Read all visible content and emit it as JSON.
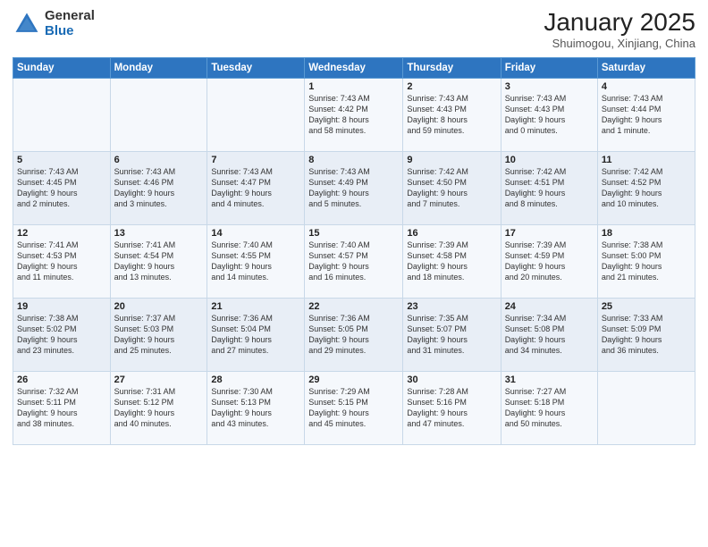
{
  "header": {
    "logo_general": "General",
    "logo_blue": "Blue",
    "title": "January 2025",
    "location": "Shuimogou, Xinjiang, China"
  },
  "calendar": {
    "days_of_week": [
      "Sunday",
      "Monday",
      "Tuesday",
      "Wednesday",
      "Thursday",
      "Friday",
      "Saturday"
    ],
    "weeks": [
      [
        {
          "day": "",
          "content": ""
        },
        {
          "day": "",
          "content": ""
        },
        {
          "day": "",
          "content": ""
        },
        {
          "day": "1",
          "content": "Sunrise: 7:43 AM\nSunset: 4:42 PM\nDaylight: 8 hours\nand 58 minutes."
        },
        {
          "day": "2",
          "content": "Sunrise: 7:43 AM\nSunset: 4:43 PM\nDaylight: 8 hours\nand 59 minutes."
        },
        {
          "day": "3",
          "content": "Sunrise: 7:43 AM\nSunset: 4:43 PM\nDaylight: 9 hours\nand 0 minutes."
        },
        {
          "day": "4",
          "content": "Sunrise: 7:43 AM\nSunset: 4:44 PM\nDaylight: 9 hours\nand 1 minute."
        }
      ],
      [
        {
          "day": "5",
          "content": "Sunrise: 7:43 AM\nSunset: 4:45 PM\nDaylight: 9 hours\nand 2 minutes."
        },
        {
          "day": "6",
          "content": "Sunrise: 7:43 AM\nSunset: 4:46 PM\nDaylight: 9 hours\nand 3 minutes."
        },
        {
          "day": "7",
          "content": "Sunrise: 7:43 AM\nSunset: 4:47 PM\nDaylight: 9 hours\nand 4 minutes."
        },
        {
          "day": "8",
          "content": "Sunrise: 7:43 AM\nSunset: 4:49 PM\nDaylight: 9 hours\nand 5 minutes."
        },
        {
          "day": "9",
          "content": "Sunrise: 7:42 AM\nSunset: 4:50 PM\nDaylight: 9 hours\nand 7 minutes."
        },
        {
          "day": "10",
          "content": "Sunrise: 7:42 AM\nSunset: 4:51 PM\nDaylight: 9 hours\nand 8 minutes."
        },
        {
          "day": "11",
          "content": "Sunrise: 7:42 AM\nSunset: 4:52 PM\nDaylight: 9 hours\nand 10 minutes."
        }
      ],
      [
        {
          "day": "12",
          "content": "Sunrise: 7:41 AM\nSunset: 4:53 PM\nDaylight: 9 hours\nand 11 minutes."
        },
        {
          "day": "13",
          "content": "Sunrise: 7:41 AM\nSunset: 4:54 PM\nDaylight: 9 hours\nand 13 minutes."
        },
        {
          "day": "14",
          "content": "Sunrise: 7:40 AM\nSunset: 4:55 PM\nDaylight: 9 hours\nand 14 minutes."
        },
        {
          "day": "15",
          "content": "Sunrise: 7:40 AM\nSunset: 4:57 PM\nDaylight: 9 hours\nand 16 minutes."
        },
        {
          "day": "16",
          "content": "Sunrise: 7:39 AM\nSunset: 4:58 PM\nDaylight: 9 hours\nand 18 minutes."
        },
        {
          "day": "17",
          "content": "Sunrise: 7:39 AM\nSunset: 4:59 PM\nDaylight: 9 hours\nand 20 minutes."
        },
        {
          "day": "18",
          "content": "Sunrise: 7:38 AM\nSunset: 5:00 PM\nDaylight: 9 hours\nand 21 minutes."
        }
      ],
      [
        {
          "day": "19",
          "content": "Sunrise: 7:38 AM\nSunset: 5:02 PM\nDaylight: 9 hours\nand 23 minutes."
        },
        {
          "day": "20",
          "content": "Sunrise: 7:37 AM\nSunset: 5:03 PM\nDaylight: 9 hours\nand 25 minutes."
        },
        {
          "day": "21",
          "content": "Sunrise: 7:36 AM\nSunset: 5:04 PM\nDaylight: 9 hours\nand 27 minutes."
        },
        {
          "day": "22",
          "content": "Sunrise: 7:36 AM\nSunset: 5:05 PM\nDaylight: 9 hours\nand 29 minutes."
        },
        {
          "day": "23",
          "content": "Sunrise: 7:35 AM\nSunset: 5:07 PM\nDaylight: 9 hours\nand 31 minutes."
        },
        {
          "day": "24",
          "content": "Sunrise: 7:34 AM\nSunset: 5:08 PM\nDaylight: 9 hours\nand 34 minutes."
        },
        {
          "day": "25",
          "content": "Sunrise: 7:33 AM\nSunset: 5:09 PM\nDaylight: 9 hours\nand 36 minutes."
        }
      ],
      [
        {
          "day": "26",
          "content": "Sunrise: 7:32 AM\nSunset: 5:11 PM\nDaylight: 9 hours\nand 38 minutes."
        },
        {
          "day": "27",
          "content": "Sunrise: 7:31 AM\nSunset: 5:12 PM\nDaylight: 9 hours\nand 40 minutes."
        },
        {
          "day": "28",
          "content": "Sunrise: 7:30 AM\nSunset: 5:13 PM\nDaylight: 9 hours\nand 43 minutes."
        },
        {
          "day": "29",
          "content": "Sunrise: 7:29 AM\nSunset: 5:15 PM\nDaylight: 9 hours\nand 45 minutes."
        },
        {
          "day": "30",
          "content": "Sunrise: 7:28 AM\nSunset: 5:16 PM\nDaylight: 9 hours\nand 47 minutes."
        },
        {
          "day": "31",
          "content": "Sunrise: 7:27 AM\nSunset: 5:18 PM\nDaylight: 9 hours\nand 50 minutes."
        },
        {
          "day": "",
          "content": ""
        }
      ]
    ]
  }
}
